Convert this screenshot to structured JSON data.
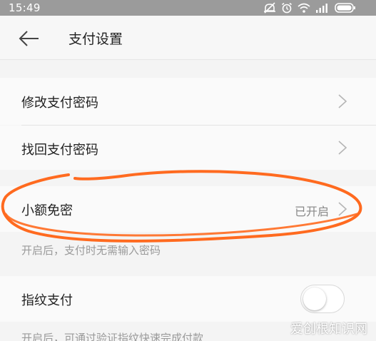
{
  "status_bar": {
    "time": "15:49"
  },
  "header": {
    "title": "支付设置"
  },
  "settings": {
    "change_password": "修改支付密码",
    "recover_password": "找回支付密码",
    "small_free": {
      "label": "小额免密",
      "value": "已开启"
    },
    "small_free_hint": "开启后，支付时无需输入密码",
    "fingerprint": {
      "label": "指纹支付",
      "enabled": false
    },
    "fingerprint_hint": "开启后，可通过验证指纹快速完成付款"
  },
  "watermark": "爱创根知识网",
  "colors": {
    "annotation": "#ff6a1f",
    "status_bar": "#9b9b9b"
  }
}
